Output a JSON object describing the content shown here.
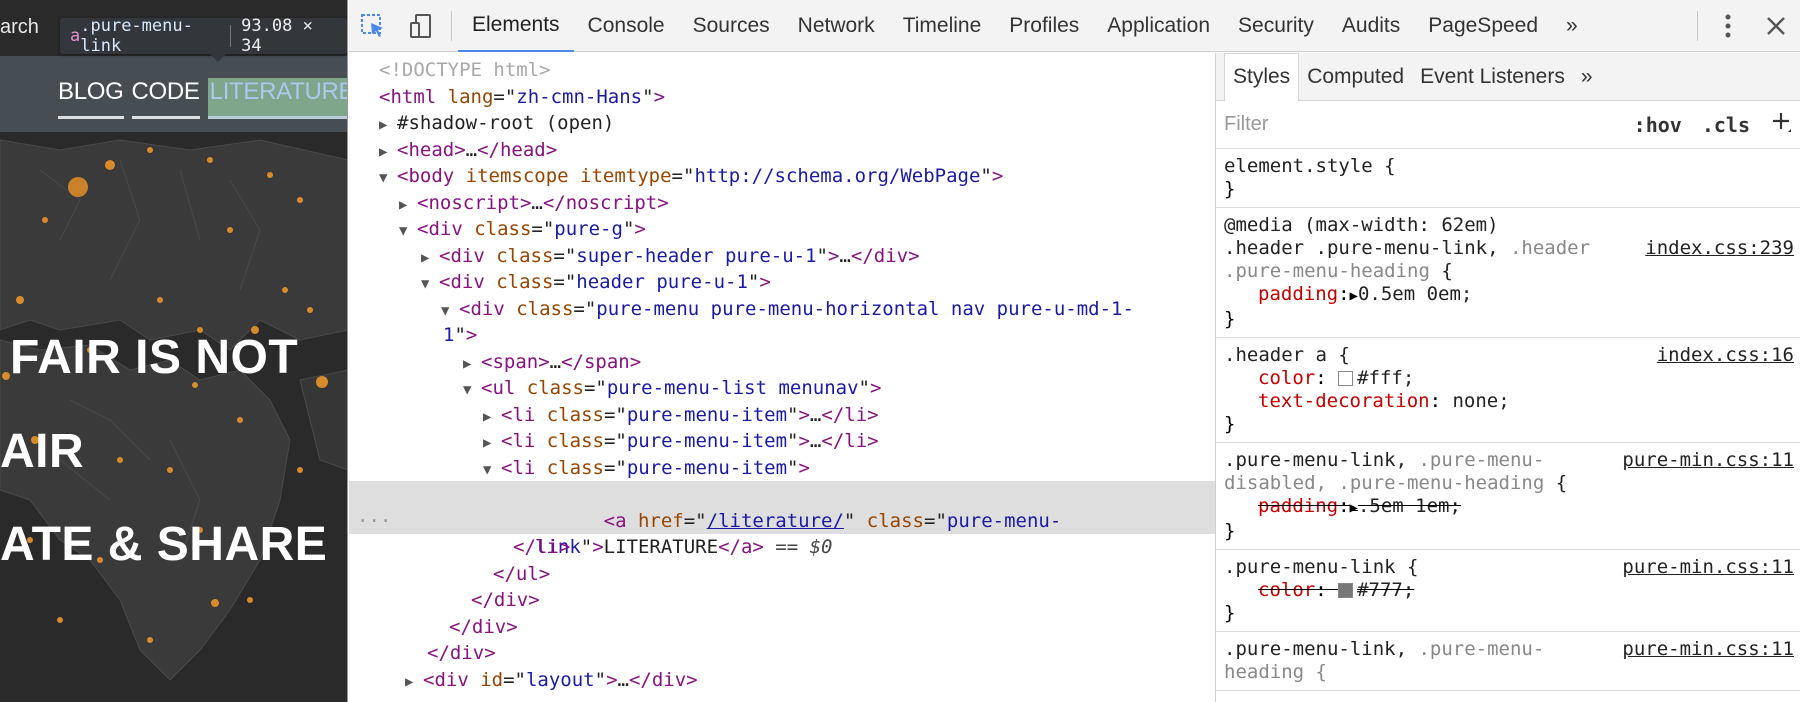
{
  "page": {
    "search_fragment": "arch",
    "tooltip": {
      "tag": "a",
      "class": ".pure-menu-link",
      "dimensions": "93.08 × 34"
    },
    "nav": [
      "BLOG",
      "CODE",
      "LITERATURE"
    ],
    "headlines": [
      "FAIR IS NOT",
      "AIR",
      "ATE & SHARE"
    ]
  },
  "devtools": {
    "tabs": [
      "Elements",
      "Console",
      "Sources",
      "Network",
      "Timeline",
      "Profiles",
      "Application",
      "Security",
      "Audits",
      "PageSpeed"
    ],
    "active_tab": "Elements",
    "more_tabs": "»",
    "dom": {
      "l1": "<!DOCTYPE html>",
      "html_lang": "zh-cmn-Hans",
      "shadow": "#shadow-root (open)",
      "head": "…",
      "body_itemtype": "http://schema.org/WebPage",
      "noscript": "…",
      "div_pure_g": "pure-g",
      "super_header": "super-header pure-u-1",
      "header": "header pure-u-1",
      "menu_class_1": "pure-menu pure-menu-horizontal nav pure-u-md-1-",
      "menu_class_2": "1",
      "ul_class": "pure-menu-list menunav",
      "li_class": "pure-menu-item",
      "a_href": "/literature/",
      "a_class_1": "pure-menu-",
      "a_class_2": "link",
      "a_text": "LITERATURE",
      "selected_marker": "== $0",
      "layout_id": "layout"
    },
    "styles_tabs": [
      "Styles",
      "Computed",
      "Event Listeners"
    ],
    "filter_placeholder": "Filter",
    "hov": ":hov",
    "cls": ".cls",
    "rules": {
      "element_style": "element.style {",
      "media": "@media (max-width: 62em)",
      "r1_sel_a": ".header .pure-menu-link, ",
      "r1_sel_b": ".header",
      "r1_sel_c": ".pure-menu-heading",
      "r1_src": "index.css:239",
      "r1_prop": "padding",
      "r1_val": "0.5em 0em;",
      "r2_sel": ".header a {",
      "r2_src": "index.css:16",
      "r2_p1": "color",
      "r2_v1": "#fff;",
      "r2_p2": "text-decoration",
      "r2_v2": "none;",
      "r3_sel_a": ".pure-menu-link, ",
      "r3_sel_b": ".pure-menu-",
      "r3_sel_c": "disabled, .pure-menu-heading",
      "r3_src": "pure-min.css:11",
      "r3_prop": "padding",
      "r3_val": ".5em 1em;",
      "r4_sel": ".pure-menu-link {",
      "r4_src": "pure-min.css:11",
      "r4_prop": "color",
      "r4_val": "#777;",
      "r5_sel_a": ".pure-menu-link, ",
      "r5_sel_b": ".pure-menu-",
      "r5_sel_c": "heading {",
      "r5_src": "pure-min.css:11"
    }
  },
  "colors": {
    "accent": "#4d8ae8",
    "tag": "#881280",
    "attr": "#994500",
    "value": "#1a1aa6",
    "prop": "#c80000"
  }
}
